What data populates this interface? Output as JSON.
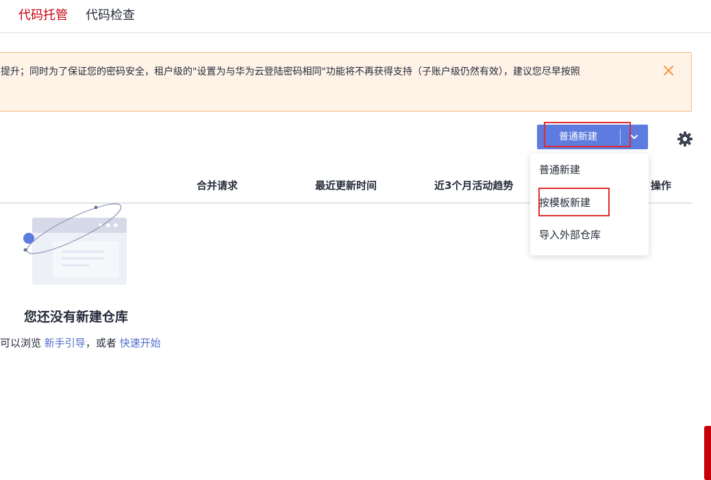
{
  "nav": {
    "tabs": [
      {
        "label": "代码托管",
        "active": true
      },
      {
        "label": "代码检查",
        "active": false
      }
    ]
  },
  "notice": {
    "text": "提升；同时为了保证您的密码安全，租户级的\"设置为与华为云登陆密码相同\"功能将不再获得支持（子账户级仍然有效），建议您尽早按照",
    "close_icon": "close-icon"
  },
  "toolbar": {
    "create_label": "普通新建",
    "dropdown_icon": "chevron-down-icon",
    "settings_icon": "gear-icon"
  },
  "dropdown": {
    "items": [
      {
        "label": "普通新建"
      },
      {
        "label": "按模板新建"
      },
      {
        "label": "导入外部仓库"
      }
    ]
  },
  "table": {
    "headers": {
      "merge": "合并请求",
      "updated": "最近更新时间",
      "trend": "近3个月活动趋势",
      "ops": "操作"
    }
  },
  "empty": {
    "title": "您还没有新建仓库",
    "hint_prefix": "可以浏览",
    "guide_link": "新手引导",
    "hint_middle": "，或者",
    "quickstart_link": "快速开始"
  },
  "colors": {
    "brand": "#c7000b",
    "primary": "#5e7ce0",
    "link": "#526ecc",
    "notice_bg": "#fff3e8",
    "notice_border": "#f7b97c",
    "highlight": "#e0292b"
  }
}
